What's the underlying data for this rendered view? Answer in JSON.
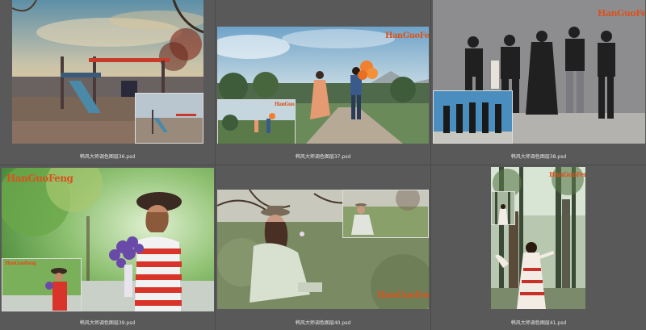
{
  "files": [
    {
      "name": "韩风大师调色图层36.psd"
    },
    {
      "name": "韩风大师调色图层37.psd"
    },
    {
      "name": "韩风大师调色图层38.psd"
    },
    {
      "name": "韩风大师调色图层39.psd"
    },
    {
      "name": "韩风大师调色图层40.psd"
    },
    {
      "name": "韩风大师调色图层41.psd"
    }
  ],
  "watermark": "HanGuoFeng",
  "colors": {
    "background": "#595959",
    "caption_text": "#e8e8e8",
    "logo": "#d9531e"
  }
}
